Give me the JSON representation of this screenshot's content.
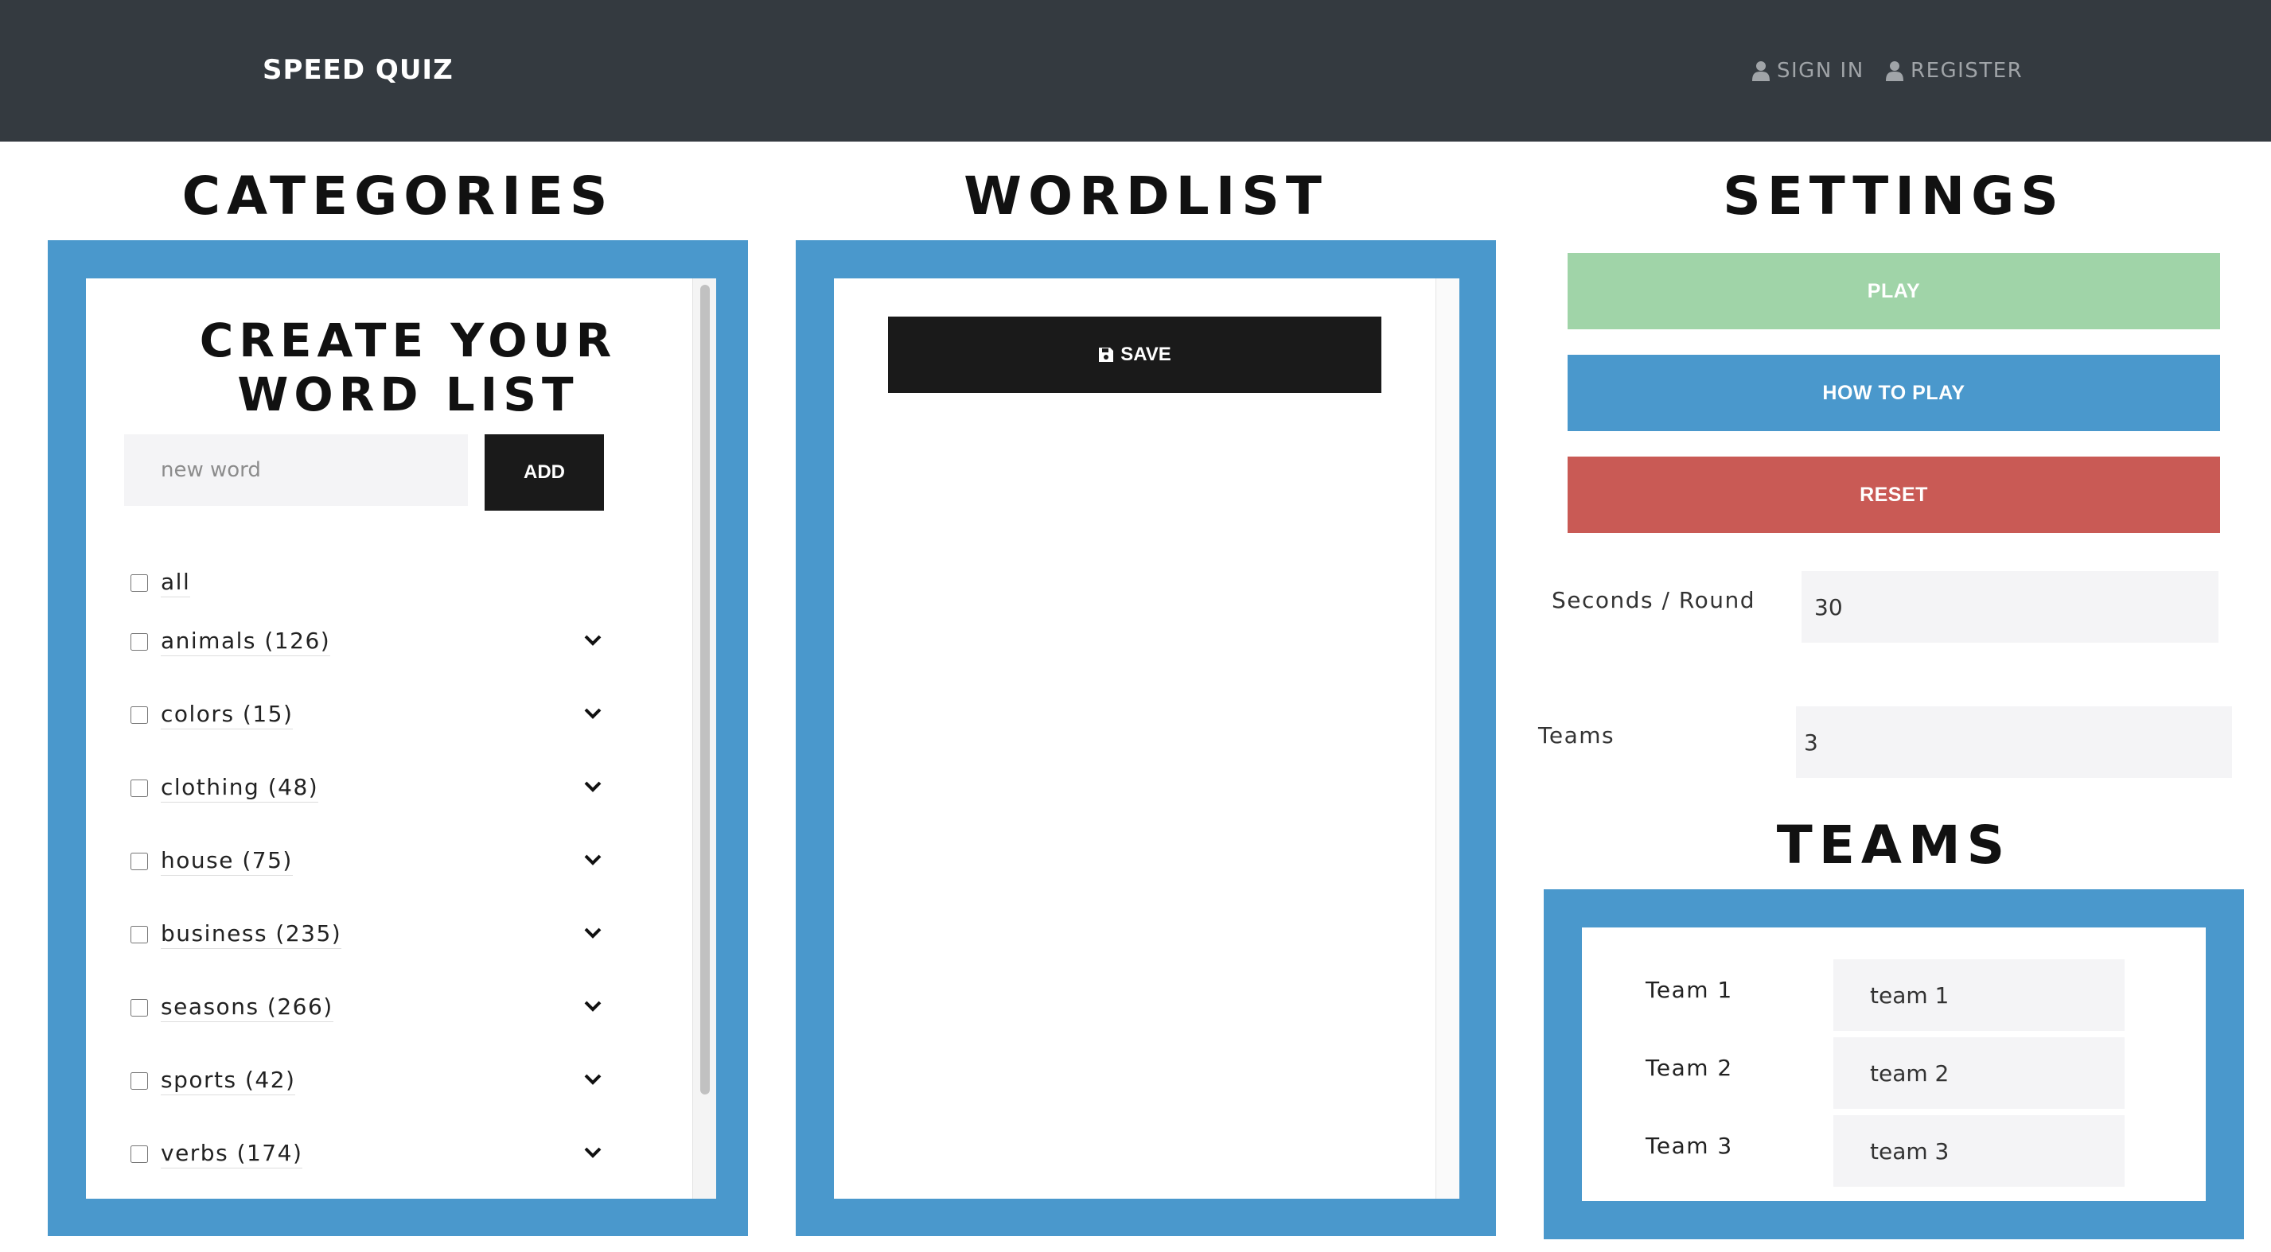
{
  "navbar": {
    "brand": "SPEED QUIZ",
    "sign_in": "SIGN IN",
    "register": "REGISTER"
  },
  "categories": {
    "heading": "CATEGORIES",
    "create_title": "CREATE YOUR WORD LIST",
    "new_word_placeholder": "new word",
    "add_label": "ADD",
    "items": [
      {
        "label": "all",
        "checked": false,
        "expandable": false
      },
      {
        "label": "animals (126)",
        "checked": false,
        "expandable": true
      },
      {
        "label": "colors (15)",
        "checked": false,
        "expandable": true
      },
      {
        "label": "clothing (48)",
        "checked": false,
        "expandable": true
      },
      {
        "label": "house (75)",
        "checked": false,
        "expandable": true
      },
      {
        "label": "business (235)",
        "checked": false,
        "expandable": true
      },
      {
        "label": "seasons (266)",
        "checked": false,
        "expandable": true
      },
      {
        "label": "sports (42)",
        "checked": false,
        "expandable": true
      },
      {
        "label": "verbs (174)",
        "checked": false,
        "expandable": true
      }
    ]
  },
  "wordlist": {
    "heading": "WORDLIST",
    "save_label": "SAVE"
  },
  "settings": {
    "heading": "SETTINGS",
    "play_label": "PLAY",
    "how_to_play_label": "HOW TO PLAY",
    "reset_label": "RESET",
    "seconds_label": "Seconds / Round",
    "seconds_value": "30",
    "teams_label": "Teams",
    "teams_value": "3"
  },
  "teams": {
    "heading": "TEAMS",
    "items": [
      {
        "label": "Team 1",
        "value": "team 1"
      },
      {
        "label": "Team 2",
        "value": "team 2"
      },
      {
        "label": "Team 3",
        "value": "team 3"
      }
    ]
  },
  "colors": {
    "navbar": "#343a40",
    "frame_blue": "#4a98cc",
    "play_green": "#a0d4a8",
    "reset_red": "#c95a55",
    "button_dark": "#1a1a1a"
  }
}
